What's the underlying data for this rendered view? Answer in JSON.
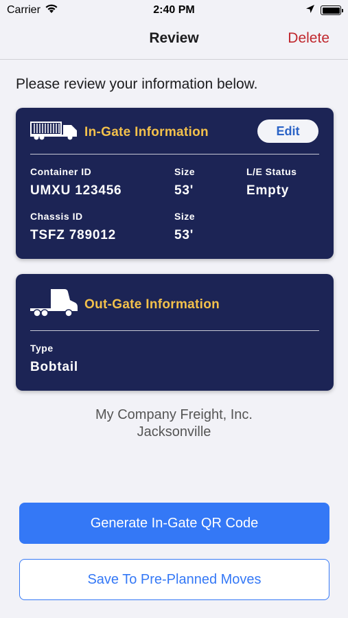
{
  "status_bar": {
    "carrier": "Carrier",
    "time": "2:40 PM",
    "icons": [
      "wifi-icon",
      "location-icon",
      "battery-icon"
    ]
  },
  "nav": {
    "title": "Review",
    "delete_label": "Delete"
  },
  "intro_text": "Please review your information below.",
  "in_gate": {
    "icon": "container-truck-icon",
    "title": "In-Gate Information",
    "edit_label": "Edit",
    "fields": {
      "container_id_label": "Container ID",
      "container_id_value": "UMXU 123456",
      "container_size_label": "Size",
      "container_size_value": "53'",
      "le_status_label": "L/E Status",
      "le_status_value": "Empty",
      "chassis_id_label": "Chassis ID",
      "chassis_id_value": "TSFZ 789012",
      "chassis_size_label": "Size",
      "chassis_size_value": "53'"
    }
  },
  "out_gate": {
    "icon": "bobtail-truck-icon",
    "title": "Out-Gate Information",
    "type_label": "Type",
    "type_value": "Bobtail"
  },
  "company": {
    "name": "My Company Freight, Inc.",
    "location": "Jacksonville"
  },
  "buttons": {
    "generate_label": "Generate In-Gate QR Code",
    "save_label": "Save To Pre-Planned Moves"
  },
  "colors": {
    "card_bg": "#1c2455",
    "card_title": "#f3c14b",
    "accent_blue": "#3478f6",
    "delete_red": "#c0272d"
  }
}
